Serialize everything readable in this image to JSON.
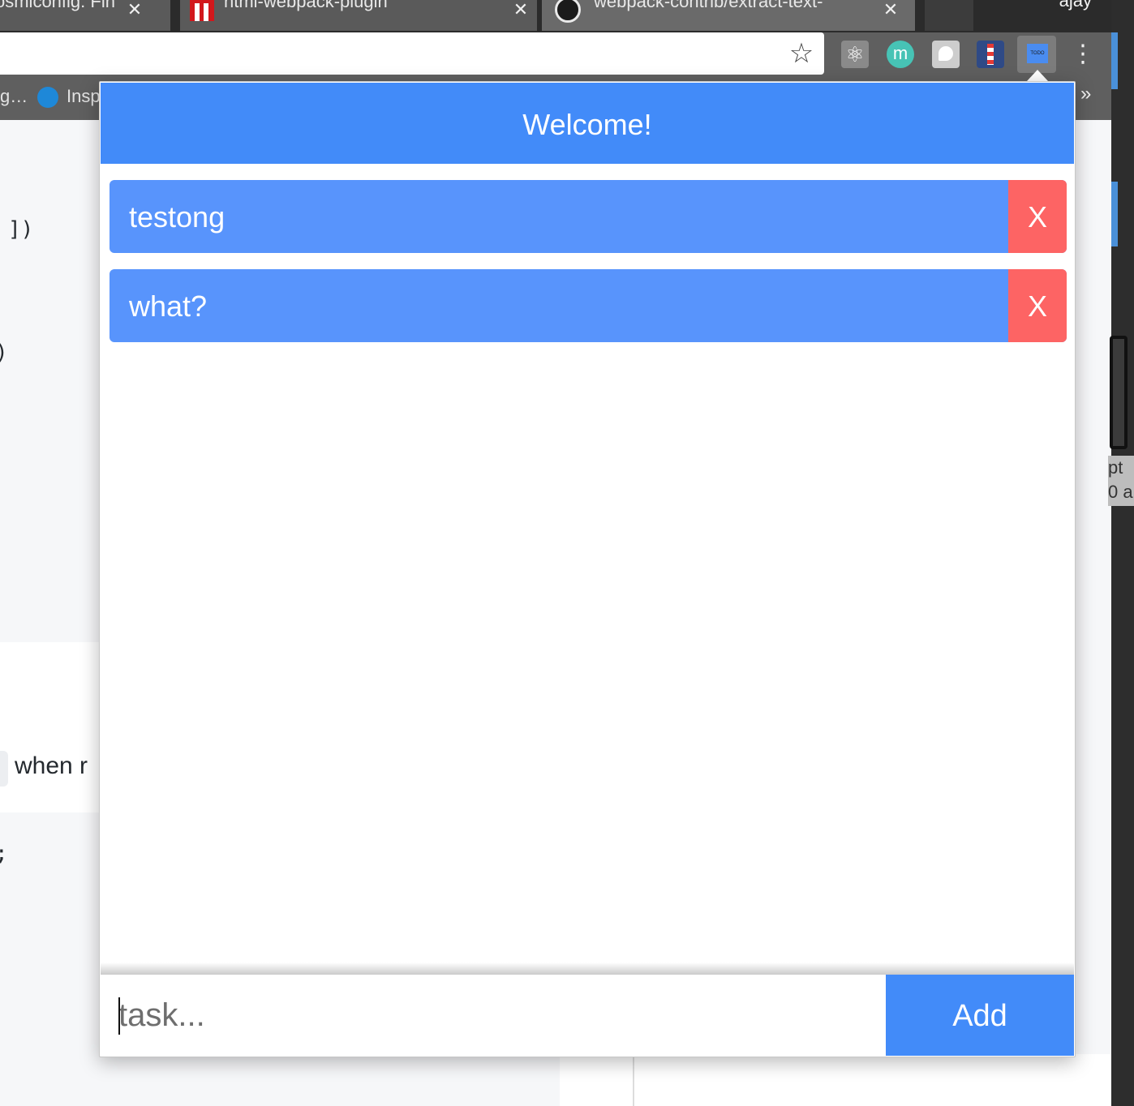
{
  "browser": {
    "tabs": [
      {
        "label": "osmiconfig: Fin",
        "close": "✕"
      },
      {
        "label": "html-webpack-plugin",
        "close": "✕"
      },
      {
        "label": "webpack-contrib/extract-text-",
        "close": "✕"
      }
    ],
    "profile_name": "ajay",
    "bookmarks": {
      "item_1": "g…",
      "item_2": "Insp",
      "more": "»"
    },
    "icons": {
      "star": "☆",
      "react": "⚛",
      "m": "m",
      "todo": "TODO",
      "menu": "⋮"
    }
  },
  "background_page": {
    "code_1": "])",
    "code_2": ")",
    "code_3": ";",
    "text_when": "when r",
    "right_text": "pt\n0 a"
  },
  "popup": {
    "title": "Welcome!",
    "tasks": [
      {
        "label": "testong",
        "delete_label": "X"
      },
      {
        "label": "what?",
        "delete_label": "X"
      }
    ],
    "input": {
      "value": "",
      "placeholder": "task..."
    },
    "add_label": "Add"
  },
  "colors": {
    "header": "#428bf9",
    "task_bg": "#5894fc",
    "delete_bg": "#fd6464",
    "add_bg": "#428bf9"
  }
}
